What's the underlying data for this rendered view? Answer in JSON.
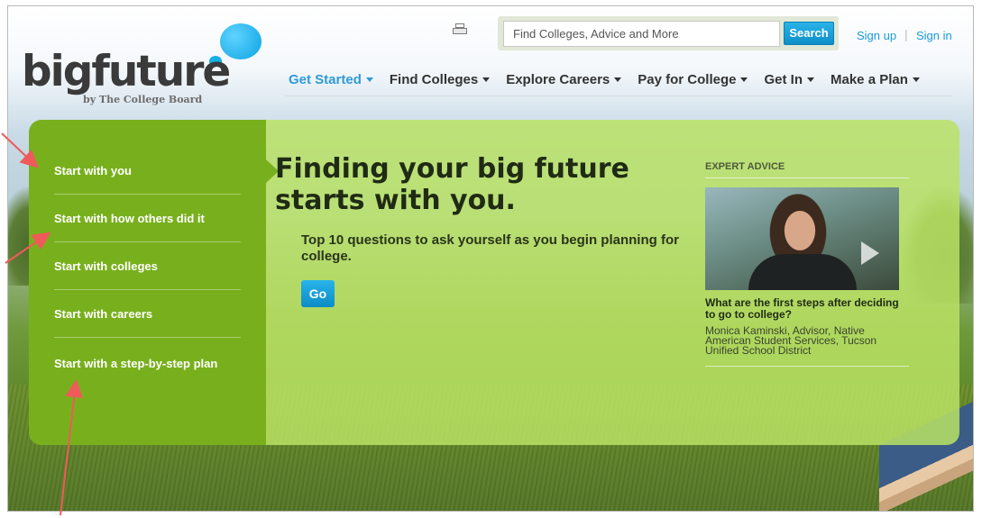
{
  "header": {
    "logo_text": "bigfuture",
    "logo_tagline": "by The College Board",
    "search_placeholder": "Find Colleges, Advice and More",
    "search_button": "Search",
    "sign_up": "Sign up",
    "separator": "|",
    "sign_in": "Sign in"
  },
  "nav": [
    {
      "label": "Get Started",
      "active": true
    },
    {
      "label": "Find Colleges"
    },
    {
      "label": "Explore Careers"
    },
    {
      "label": "Pay for College"
    },
    {
      "label": "Get In"
    },
    {
      "label": "Make a Plan"
    }
  ],
  "sidebar": {
    "items": [
      {
        "label": "Start with you"
      },
      {
        "label": "Start with how others did it"
      },
      {
        "label": "Start with colleges"
      },
      {
        "label": "Start with careers"
      },
      {
        "label": "Start with a step-by-step plan"
      }
    ]
  },
  "main": {
    "headline": "Finding your big future starts with you.",
    "subhead": "Top 10 questions to ask yourself as you begin planning for college.",
    "go_button": "Go"
  },
  "expert": {
    "title": "EXPERT ADVICE",
    "question": "What are the first steps after deciding to go to college?",
    "credit": "Monica Kaminski, Advisor, Native American Student Services, Tucson Unified School District"
  },
  "colors": {
    "accent_blue": "#1a9bd7",
    "sidebar_green": "#78b01d",
    "panel_green": "#bae264",
    "annotation_red": "#f05a5a"
  }
}
